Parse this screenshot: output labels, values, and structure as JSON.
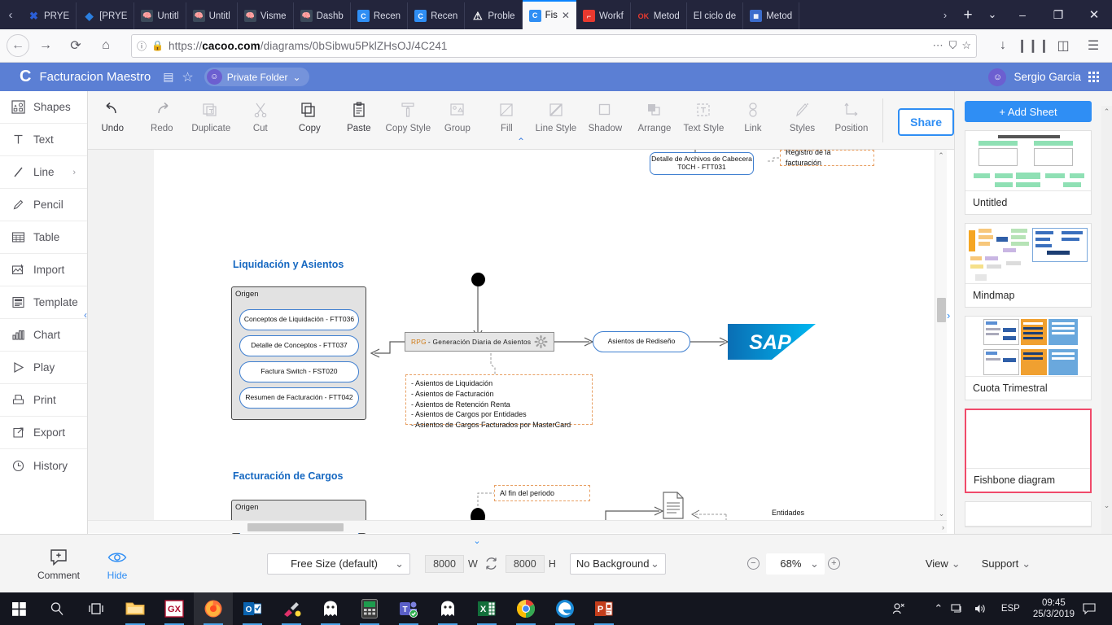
{
  "browser": {
    "tabs": [
      {
        "label": "PRYE",
        "favicon": "x-logo-icon",
        "color": "#2b5ed6",
        "active": false
      },
      {
        "label": "[PRYE",
        "favicon": "diamond-icon",
        "color": "#1b6ec2",
        "active": false
      },
      {
        "label": "Untitl",
        "favicon": "brain-icon",
        "color": "#3c4a5a",
        "active": false
      },
      {
        "label": "Untitl",
        "favicon": "brain-icon",
        "color": "#3c4a5a",
        "active": false
      },
      {
        "label": "Visme",
        "favicon": "brain-icon",
        "color": "#3c4a5a",
        "active": false
      },
      {
        "label": "Dashb",
        "favicon": "brain-icon",
        "color": "#3c4a5a",
        "active": false
      },
      {
        "label": "Recen",
        "favicon": "cacoo-icon",
        "color": "#2f8ef4",
        "active": false
      },
      {
        "label": "Recen",
        "favicon": "cacoo-icon",
        "color": "#2f8ef4",
        "active": false
      },
      {
        "label": "Proble",
        "favicon": "warning-icon",
        "color": "#ffffff",
        "active": false
      },
      {
        "label": "Fis",
        "favicon": "cacoo-icon",
        "color": "#2f8ef4",
        "active": true
      },
      {
        "label": "Workf",
        "favicon": "red-square-icon",
        "color": "#e8392f",
        "active": false
      },
      {
        "label": "Metod",
        "favicon": "ok-hosting-icon",
        "color": "#e8392f",
        "active": false
      },
      {
        "label": "El ciclo de",
        "favicon": "none",
        "color": "#2b2d42",
        "active": false
      },
      {
        "label": "Metod",
        "favicon": "blue-glyph-icon",
        "color": "#3b6ccc",
        "active": false
      }
    ],
    "tab_close_label": "✕",
    "new_tab_label": "+",
    "list_all_tabs_label": "⌄",
    "scroll_left_label": "‹",
    "scroll_right_label": "›",
    "window_minimize": "–",
    "window_restore": "❐",
    "window_close": "✕",
    "url_prefix": "https://",
    "url_domain": "cacoo.com",
    "url_path": "/diagrams/0bSibwu5PklZHsOJ/4C241",
    "nav": {
      "back": "←",
      "forward": "→",
      "reload": "⟳",
      "home": "⌂",
      "page_actions": "⋯",
      "save_to_pocket": "Ⓖ",
      "bookmark": "☆",
      "download": "↓",
      "library": "☰‖",
      "sidebar": "◫",
      "menu": "☰"
    }
  },
  "cacoo_header": {
    "logo": "cacoo-c-logo",
    "title": "Facturacion Maestro",
    "diagram_icon": "diagram-structure-icon",
    "star_icon": "star-outline-icon",
    "folder_label": "Private Folder",
    "folder_chevron": "⌄",
    "user_name": "Sergio Garcia",
    "apps_grid_icon": "apps-grid-icon"
  },
  "rail": {
    "items": [
      {
        "label": "Shapes",
        "icon": "shapes-icon",
        "chevron": false
      },
      {
        "label": "Text",
        "icon": "text-t-icon",
        "chevron": false
      },
      {
        "label": "Line",
        "icon": "line-icon",
        "chevron": true
      },
      {
        "label": "Pencil",
        "icon": "pencil-icon",
        "chevron": false
      },
      {
        "label": "Table",
        "icon": "table-grid-icon",
        "chevron": false
      },
      {
        "label": "Import",
        "icon": "import-image-icon",
        "chevron": false
      },
      {
        "label": "Template",
        "icon": "template-icon",
        "chevron": false
      },
      {
        "label": "Chart",
        "icon": "bar-chart-icon",
        "chevron": false
      },
      {
        "label": "Play",
        "icon": "play-triangle-icon",
        "chevron": false
      },
      {
        "label": "Print",
        "icon": "printer-icon",
        "chevron": false
      },
      {
        "label": "Export",
        "icon": "export-arrow-icon",
        "chevron": false
      },
      {
        "label": "History",
        "icon": "clock-history-icon",
        "chevron": false
      }
    ],
    "collapse_chevron": "‹"
  },
  "toolbar": {
    "items": [
      {
        "label": "Undo",
        "icon": "undo-arrow-icon",
        "enabled": true
      },
      {
        "label": "Redo",
        "icon": "redo-arrow-icon",
        "enabled": false
      },
      {
        "label": "Duplicate",
        "icon": "duplicate-icon",
        "enabled": false
      },
      {
        "label": "Cut",
        "icon": "scissors-icon",
        "enabled": false
      },
      {
        "label": "Copy",
        "icon": "copy-icon",
        "enabled": true
      },
      {
        "label": "Paste",
        "icon": "clipboard-icon",
        "enabled": true
      },
      {
        "label": "Copy Style",
        "icon": "paint-roller-icon",
        "enabled": false
      },
      {
        "label": "Group",
        "icon": "group-icon",
        "enabled": false
      },
      {
        "label": "Fill",
        "icon": "fill-square-icon",
        "enabled": false
      },
      {
        "label": "Line Style",
        "icon": "line-style-icon",
        "enabled": false
      },
      {
        "label": "Shadow",
        "icon": "shadow-square-icon",
        "enabled": false
      },
      {
        "label": "Arrange",
        "icon": "arrange-layers-icon",
        "enabled": false
      },
      {
        "label": "Text Style",
        "icon": "text-style-icon",
        "enabled": false
      },
      {
        "label": "Link",
        "icon": "link-chain-icon",
        "enabled": false
      },
      {
        "label": "Styles",
        "icon": "styles-pen-icon",
        "enabled": false
      },
      {
        "label": "Position",
        "icon": "position-axes-icon",
        "enabled": false
      }
    ],
    "share_label": "Share",
    "collapse_chevron": "⌃"
  },
  "canvas": {
    "sections": [
      {
        "title": "Liquidación y Asientos"
      },
      {
        "title": "Facturación de Cargos"
      }
    ],
    "top_node": {
      "line1": "Detalle de Archivos de Cabecera",
      "line2": "T0CH - FTT031"
    },
    "top_note": "Registro de la facturación",
    "origin_label_1": "Origen",
    "origin_label_2": "Origen",
    "origin_items": [
      "Conceptos de Liquidación - FTT036",
      "Detalle de Conceptos - FTT037",
      "Factura Switch - FST020",
      "Resumen de Facturación - FTT042"
    ],
    "process_tag": "RPG",
    "process_label": "- Generación Diaria de Asientos",
    "process_gear_icon": "gear-icon",
    "note_lines": [
      "- Asientos de Liquidación",
      "- Asientos de Facturación",
      "- Asientos de Retención Renta",
      "- Asientos de Cargos por Entidades",
      "- Asientos de Cargos Facturados por MasterCard"
    ],
    "output_node": "Asientos de Rediseño",
    "sap_label": "SAP",
    "sap_reg": "®",
    "period_note": "Al fin del periodo",
    "entities_label": "Entidades",
    "document_icon": "document-page-icon"
  },
  "sheets": {
    "add_sheet_label": "+ Add Sheet",
    "scroll_up": "⌃",
    "scroll_down": "⌄",
    "items": [
      {
        "name": "Untitled",
        "selected": false,
        "thumb": "flowchart-green"
      },
      {
        "name": "Mindmap",
        "selected": false,
        "thumb": "mindmap-colored"
      },
      {
        "name": "Cuota Trimestral",
        "selected": false,
        "thumb": "orange-blue-panels"
      },
      {
        "name": "Fishbone diagram",
        "selected": true,
        "thumb": "blank"
      },
      {
        "name": "",
        "selected": false,
        "thumb": "blank"
      }
    ]
  },
  "bottombar": {
    "comment_label": "Comment",
    "comment_icon": "comment-plus-icon",
    "hide_label": "Hide",
    "hide_icon": "eye-icon",
    "size_preset": "Free Size (default)",
    "size_chevron": "⌄",
    "width_value": "8000",
    "width_unit": "W",
    "height_value": "8000",
    "height_unit": "H",
    "sync_icon": "sync-arrows-icon",
    "background_label": "No Background",
    "background_chevron": "⌄",
    "zoom_out": "−",
    "zoom_value": "68%",
    "zoom_in": "+",
    "zoom_chevron": "⌄",
    "view_label": "View",
    "support_label": "Support",
    "collapse_chevron": "⌄"
  },
  "taskbar": {
    "start_icon": "windows-start-icon",
    "search_icon": "search-magnifier-icon",
    "taskview_icon": "task-view-icon",
    "apps": [
      {
        "icon": "file-explorer-icon",
        "active": false,
        "running": true
      },
      {
        "icon": "genexus-gx-icon",
        "active": false,
        "running": true
      },
      {
        "icon": "firefox-icon",
        "active": true,
        "running": true
      },
      {
        "icon": "outlook-icon",
        "active": false,
        "running": true
      },
      {
        "icon": "paint-icon",
        "active": false,
        "running": true
      },
      {
        "icon": "ghost-app-icon",
        "active": false,
        "running": true
      },
      {
        "icon": "calculator-icon",
        "active": false,
        "running": true
      },
      {
        "icon": "teams-icon",
        "active": false,
        "running": true
      },
      {
        "icon": "ghost-app-icon",
        "active": false,
        "running": true
      },
      {
        "icon": "excel-icon",
        "active": false,
        "running": true
      },
      {
        "icon": "chrome-icon",
        "active": false,
        "running": true
      },
      {
        "icon": "edge-icon",
        "active": false,
        "running": true
      },
      {
        "icon": "powerpoint-icon",
        "active": false,
        "running": true
      }
    ],
    "people_icon": "people-icon",
    "tray_chevron": "⌃",
    "network_icon": "network-icon",
    "volume_icon": "volume-icon",
    "language": "ESP",
    "time": "09:45",
    "date": "25/3/2019",
    "notification_icon": "notification-icon"
  }
}
